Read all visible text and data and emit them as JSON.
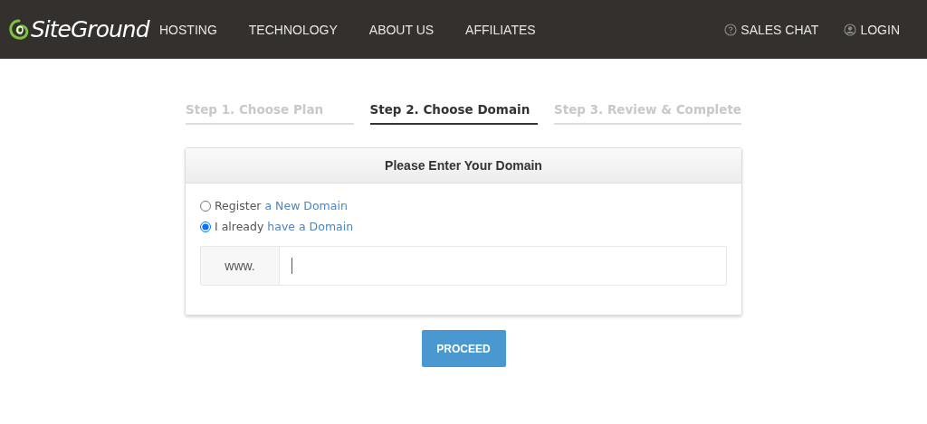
{
  "header": {
    "logo": "SiteGround",
    "nav": [
      {
        "label": "HOSTING"
      },
      {
        "label": "TECHNOLOGY"
      },
      {
        "label": "ABOUT US"
      },
      {
        "label": "AFFILIATES"
      }
    ],
    "right": [
      {
        "label": "SALES CHAT",
        "kind": "chat"
      },
      {
        "label": "LOGIN",
        "kind": "user"
      }
    ]
  },
  "steps": [
    {
      "label": "Step 1. Choose Plan",
      "selected": false
    },
    {
      "label": "Step 2. Choose Domain",
      "selected": true
    },
    {
      "label": "Step 3. Review & Complete",
      "selected": false
    }
  ],
  "card": {
    "title": "Please Enter Your Domain",
    "options": [
      {
        "text": "Register",
        "link": "a New Domain",
        "selected": false
      },
      {
        "text": "I already",
        "link": "have a Domain",
        "selected": true
      }
    ],
    "prefix": "www."
  },
  "button": "PROCEED"
}
